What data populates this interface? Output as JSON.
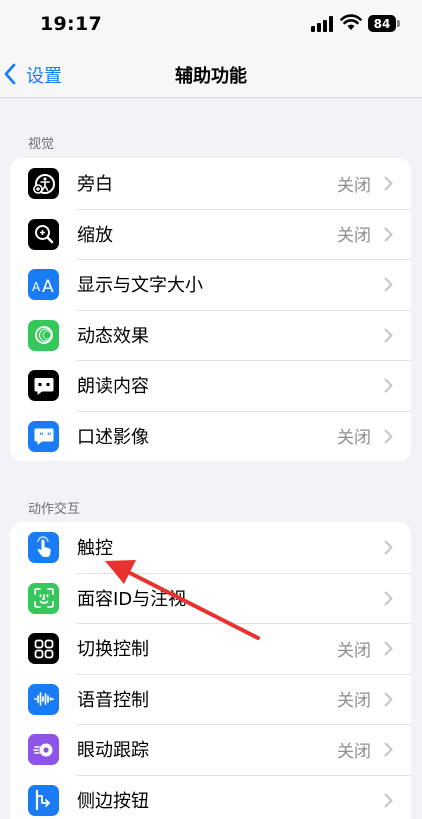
{
  "status_bar": {
    "time": "19:17",
    "battery": "84"
  },
  "nav": {
    "back_label": "设置",
    "title": "辅助功能"
  },
  "sections": [
    {
      "header": "视觉",
      "rows": [
        {
          "label": "旁白",
          "value": "关闭",
          "icon": "voiceover-icon",
          "icon_bg": "#000000"
        },
        {
          "label": "缩放",
          "value": "关闭",
          "icon": "zoom-icon",
          "icon_bg": "#000000"
        },
        {
          "label": "显示与文字大小",
          "value": "",
          "icon": "text-size-icon",
          "icon_bg": "#1a7cf5"
        },
        {
          "label": "动态效果",
          "value": "",
          "icon": "motion-icon",
          "icon_bg": "#34c759"
        },
        {
          "label": "朗读内容",
          "value": "",
          "icon": "spoken-content-icon",
          "icon_bg": "#000000"
        },
        {
          "label": "口述影像",
          "value": "关闭",
          "icon": "audio-description-icon",
          "icon_bg": "#1a7cf5"
        }
      ]
    },
    {
      "header": "动作交互",
      "rows": [
        {
          "label": "触控",
          "value": "",
          "icon": "touch-icon",
          "icon_bg": "#1a7cf5"
        },
        {
          "label": "面容ID与注视",
          "value": "",
          "icon": "face-id-icon",
          "icon_bg": "#34c759"
        },
        {
          "label": "切换控制",
          "value": "关闭",
          "icon": "switch-control-icon",
          "icon_bg": "#000000"
        },
        {
          "label": "语音控制",
          "value": "关闭",
          "icon": "voice-control-icon",
          "icon_bg": "#1a7cf5"
        },
        {
          "label": "眼动跟踪",
          "value": "关闭",
          "icon": "eye-tracking-icon",
          "icon_bg": "#8e54e9"
        },
        {
          "label": "侧边按钮",
          "value": "",
          "icon": "side-button-icon",
          "icon_bg": "#1a7cf5"
        }
      ]
    }
  ],
  "annotation": {
    "color": "#e8322f"
  }
}
